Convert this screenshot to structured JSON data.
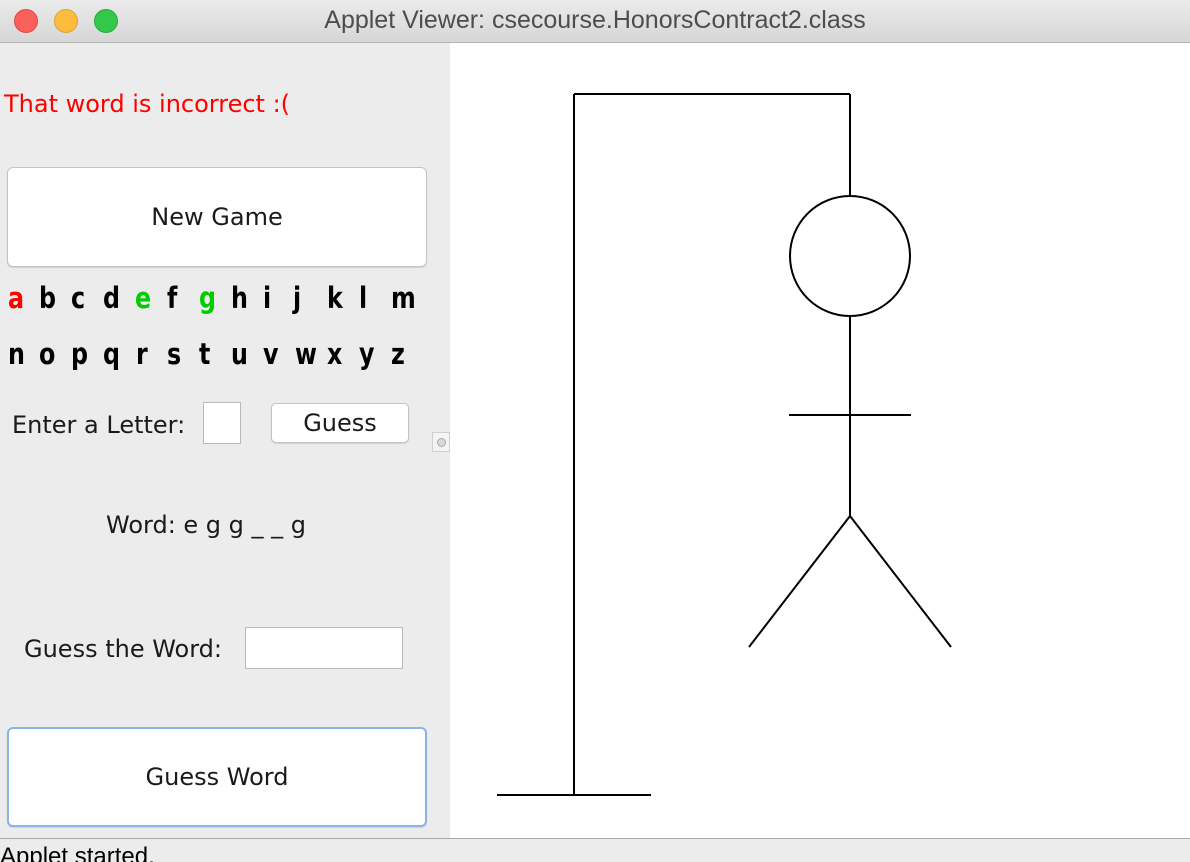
{
  "window": {
    "title": "Applet Viewer: csecourse.HonorsContract2.class"
  },
  "left_panel": {
    "status_message": "That word is incorrect :(",
    "status_color": "#ff0000",
    "new_game_label": "New Game",
    "alphabet_row1": [
      "a",
      "b",
      "c",
      "d",
      "e",
      "f",
      "g",
      "h",
      "i",
      "j",
      "k",
      "l",
      "m"
    ],
    "alphabet_row2": [
      "n",
      "o",
      "p",
      "q",
      "r",
      "s",
      "t",
      "u",
      "v",
      "w",
      "x",
      "y",
      "z"
    ],
    "letter_colors": {
      "a": "#ff0000",
      "e": "#00cc00",
      "g": "#00cc00"
    },
    "enter_letter_label": "Enter a Letter:",
    "letter_input_value": "",
    "guess_button_label": "Guess",
    "word_display": "Word: e g g _ _ g",
    "guess_word_label": "Guess the Word:",
    "word_input_value": "",
    "guess_word_button_label": "Guess Word"
  },
  "status_bar": {
    "text": "Applet started."
  }
}
